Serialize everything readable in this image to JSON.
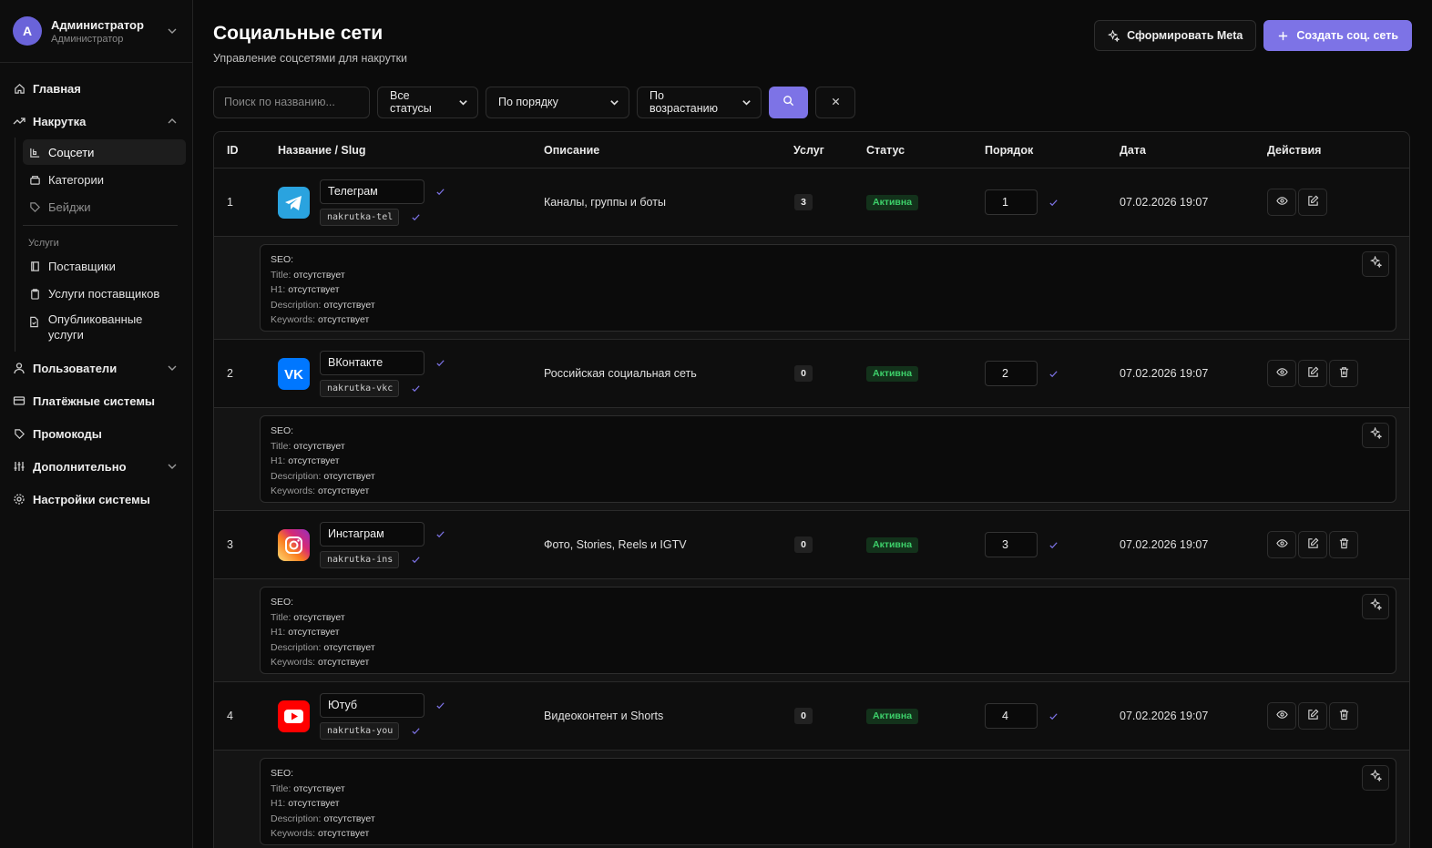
{
  "user": {
    "initial": "A",
    "name": "Администратор",
    "role": "Администратор"
  },
  "nav": {
    "home": "Главная",
    "nakrutka": "Накрутка",
    "nakrutka_items": [
      {
        "label": "Соцсети",
        "icon": "share-icon"
      },
      {
        "label": "Категории",
        "icon": "folder-icon"
      },
      {
        "label": "Бейджи",
        "icon": "tag-icon"
      }
    ],
    "services_title": "Услуги",
    "services_items": [
      {
        "label": "Поставщики",
        "icon": "book-icon"
      },
      {
        "label": "Услуги поставщиков",
        "icon": "clipboard-icon"
      },
      {
        "label": "Опубликованные услуги",
        "icon": "file-check-icon"
      }
    ],
    "users": "Пользователи",
    "payments": "Платёжные системы",
    "promo": "Промокоды",
    "extra": "Дополнительно",
    "settings": "Настройки системы"
  },
  "header": {
    "title": "Социальные сети",
    "subtitle": "Управление соцсетями для накрутки",
    "meta_button": "Сформировать Meta",
    "create_button": "Создать соц. сеть"
  },
  "filters": {
    "search_placeholder": "Поиск по названию...",
    "status": "Все статусы",
    "sort": "По порядку",
    "direction": "По возрастанию"
  },
  "table": {
    "headers": {
      "id": "ID",
      "name": "Название / Slug",
      "desc": "Описание",
      "services": "Услуг",
      "status": "Статус",
      "order": "Порядок",
      "date": "Дата",
      "actions": "Действия"
    },
    "rows": [
      {
        "id": "1",
        "name": "Телеграм",
        "slug": "nakrutka-tel",
        "desc": "Каналы, группы и боты",
        "services": "3",
        "status": "Активна",
        "order": "1",
        "date": "07.02.2026 19:07",
        "logo": "telegram-logo",
        "color": "#2aa3df"
      },
      {
        "id": "2",
        "name": "ВКонтакте",
        "slug": "nakrutka-vkc",
        "desc": "Российская социальная сеть",
        "services": "0",
        "status": "Активна",
        "order": "2",
        "date": "07.02.2026 19:07",
        "logo": "vk-logo",
        "color": "#0077ff"
      },
      {
        "id": "3",
        "name": "Инстаграм",
        "slug": "nakrutka-ins",
        "desc": "Фото, Stories, Reels и IGTV",
        "services": "0",
        "status": "Активна",
        "order": "3",
        "date": "07.02.2026 19:07",
        "logo": "instagram-logo",
        "color": "#d6249f"
      },
      {
        "id": "4",
        "name": "Ютуб",
        "slug": "nakrutka-you",
        "desc": "Видеоконтент и Shorts",
        "services": "0",
        "status": "Активна",
        "order": "4",
        "date": "07.02.2026 19:07",
        "logo": "youtube-logo",
        "color": "#ff0000"
      }
    ],
    "seo": {
      "label": "SEO:",
      "title_key": "Title:",
      "h1_key": "H1:",
      "desc_key": "Description:",
      "kw_key": "Keywords:",
      "missing": "отсутствует"
    }
  },
  "colors": {
    "accent": "#7d73e6",
    "status_green": "#3dd06a"
  }
}
